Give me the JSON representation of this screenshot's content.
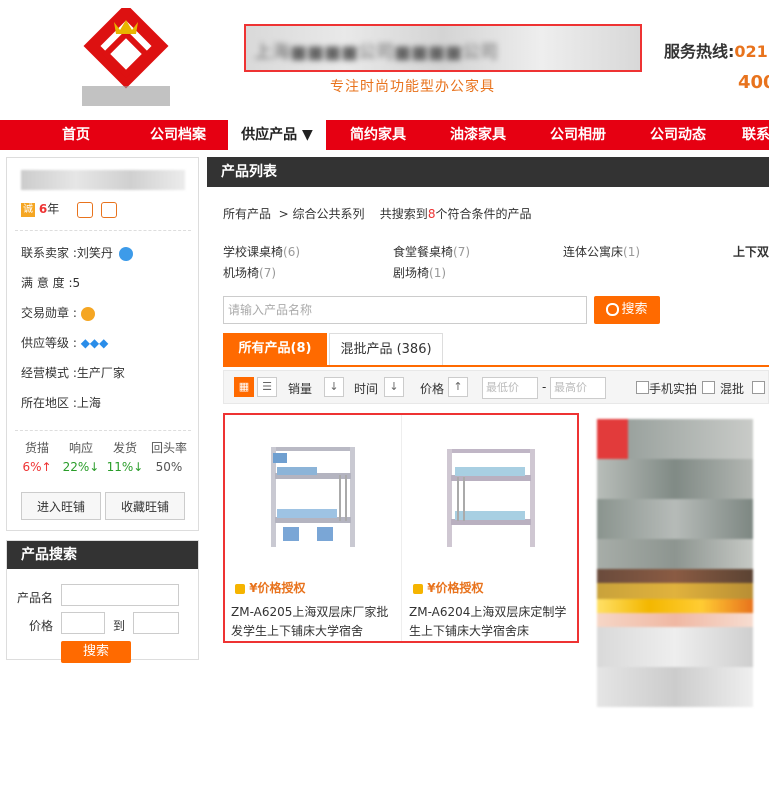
{
  "header": {
    "company_name": "上海■■■■公司■■■■公司",
    "slogan": "专注时尚功能型办公家具",
    "hotline_label": "服务热线:",
    "hotline_value": "021",
    "hotline_line2": "400"
  },
  "nav": {
    "items": [
      "首页",
      "公司档案",
      "供应产品 ▼",
      "简约家具",
      "油漆家具",
      "公司相册",
      "公司动态",
      "联系"
    ]
  },
  "shop": {
    "years": "6",
    "years_suffix": "年",
    "contact": "联系卖家 :刘笑丹",
    "satisfaction": "满 意 度 :5",
    "medal": "交易勋章 :",
    "level": "供应等级 :",
    "mode": "经营模式 :生产厂家",
    "region": "所在地区 :上海",
    "stats": [
      {
        "label": "货描",
        "value": "6%↑",
        "color": "#e33"
      },
      {
        "label": "响应",
        "value": "22%↓",
        "color": "#2a9d2a"
      },
      {
        "label": "发货",
        "value": "11%↓",
        "color": "#2a9d2a"
      },
      {
        "label": "回头率",
        "value": "50%",
        "color": "#555"
      }
    ],
    "btn_enter": "进入旺铺",
    "btn_fav": "收藏旺铺"
  },
  "search_panel": {
    "title": "产品搜索",
    "name_label": "产品名",
    "price_label": "价格",
    "to_label": "到",
    "button": "搜索"
  },
  "main": {
    "title": "产品列表",
    "crumb_all": "所有产品",
    "crumb_cat": "> 综合公共系列",
    "crumb_found_pre": "共搜索到",
    "crumb_count": "8",
    "crumb_found_post": "个符合条件的产品",
    "categories": [
      {
        "name": "学校课桌椅",
        "count": "(6)"
      },
      {
        "name": "食堂餐桌椅",
        "count": "(7)"
      },
      {
        "name": "连体公寓床",
        "count": "(1)"
      },
      {
        "name": "上下双",
        "count": ""
      },
      {
        "name": "机场椅",
        "count": "(7)"
      },
      {
        "name": "剧场椅",
        "count": "(1)"
      }
    ],
    "search_placeholder": "请输入产品名称",
    "search_button": "搜索",
    "tabs": [
      "所有产品(8)",
      "混批产品 (386)"
    ],
    "toolbar": {
      "sales": "销量",
      "time": "时间",
      "price": "价格",
      "min_price": "最低价",
      "max_price": "最高价",
      "dash": "-",
      "phone_shot": "手机实拍",
      "mixed": "混批"
    },
    "products": [
      {
        "price": "¥价格授权",
        "title": "ZM-A6205上海双层床厂家批发学生上下铺床大学宿舍"
      },
      {
        "price": "¥价格授权",
        "title": "ZM-A6204上海双层床定制学生上下铺床大学宿舍床"
      }
    ]
  },
  "colors": {
    "nav_red": "#e60012",
    "accent_orange": "#ff6a00",
    "highlight_red": "#e33"
  }
}
